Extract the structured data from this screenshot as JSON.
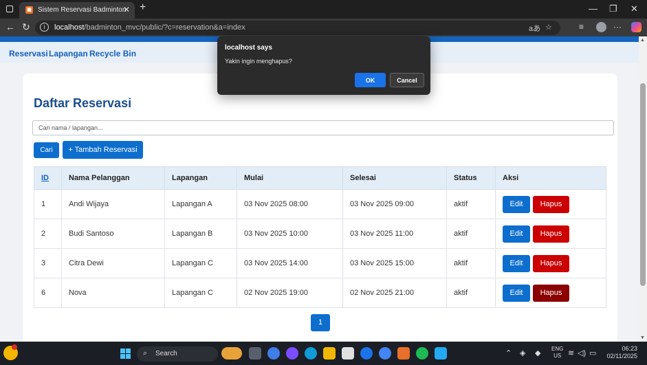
{
  "browser": {
    "tab_title": "Sistem Reservasi Badminton",
    "tab_favicon": "favicon-icon",
    "url_host": "localhost",
    "url_path": "/badminton_mvc/public/?c=reservation&a=index",
    "window_controls": [
      "minimize-icon",
      "maximize-icon",
      "close-icon"
    ]
  },
  "nav": {
    "items": [
      {
        "label": "Reservasi"
      },
      {
        "label": "Lapangan"
      },
      {
        "label": "Recycle Bin"
      }
    ]
  },
  "page": {
    "title": "Daftar Reservasi",
    "search_placeholder": "Cari nama / lapangan...",
    "search_button": "Cari",
    "add_button": "+ Tambah Reservasi"
  },
  "table": {
    "headers": [
      "ID",
      "Nama Pelanggan",
      "Lapangan",
      "Mulai",
      "Selesai",
      "Status",
      "Aksi"
    ],
    "rows": [
      {
        "id": "1",
        "nama": "Andi Wijaya",
        "lapangan": "Lapangan A",
        "mulai": "03 Nov 2025 08:00",
        "selesai": "03 Nov 2025 09:00",
        "status": "aktif"
      },
      {
        "id": "2",
        "nama": "Budi Santoso",
        "lapangan": "Lapangan B",
        "mulai": "03 Nov 2025 10:00",
        "selesai": "03 Nov 2025 11:00",
        "status": "aktif"
      },
      {
        "id": "3",
        "nama": "Citra Dewi",
        "lapangan": "Lapangan C",
        "mulai": "03 Nov 2025 14:00",
        "selesai": "03 Nov 2025 15:00",
        "status": "aktif"
      },
      {
        "id": "6",
        "nama": "Nova",
        "lapangan": "Lapangan C",
        "mulai": "02 Nov 2025 19:00",
        "selesai": "02 Nov 2025 21:00",
        "status": "aktif"
      }
    ],
    "edit_label": "Edit",
    "delete_label": "Hapus"
  },
  "pagination": {
    "current": "1"
  },
  "dialog": {
    "title": "localhost says",
    "message": "Yakin ingin menghapus?",
    "ok": "OK",
    "cancel": "Cancel"
  },
  "taskbar": {
    "search": "Search",
    "lang_top": "ENG",
    "lang_bottom": "US",
    "time": "06:23",
    "date": "02/11/2025"
  },
  "colors": {
    "primary": "#0d6ecd",
    "danger": "#cc0000",
    "danger_hover": "#8b0000",
    "title": "#1a4d8f"
  }
}
